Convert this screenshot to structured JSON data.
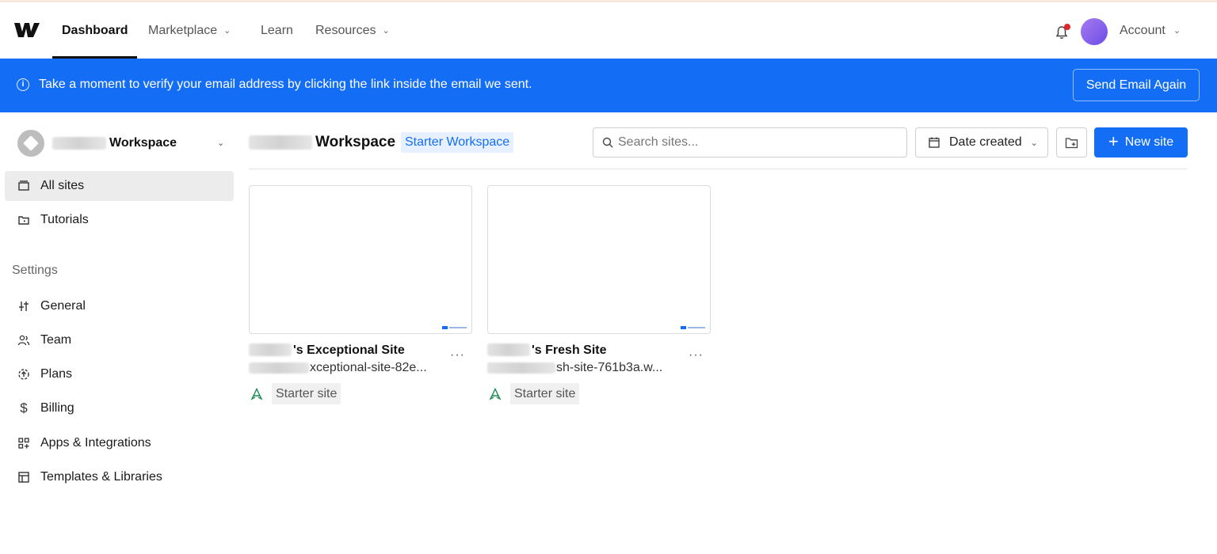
{
  "nav": {
    "items": [
      {
        "label": "Dashboard"
      },
      {
        "label": "Marketplace"
      },
      {
        "label": "Learn"
      },
      {
        "label": "Resources"
      }
    ],
    "account_label": "Account"
  },
  "banner": {
    "icon": "info-icon",
    "text": "Take a moment to verify your email address by clicking the link inside the email we sent.",
    "button_label": "Send Email Again"
  },
  "sidebar": {
    "workspace_name": "Workspace",
    "items": [
      {
        "label": "All sites",
        "icon": "all-sites-icon"
      },
      {
        "label": "Tutorials",
        "icon": "tutorials-icon"
      }
    ],
    "settings_heading": "Settings",
    "settings_items": [
      {
        "label": "General",
        "icon": "sliders-icon"
      },
      {
        "label": "Team",
        "icon": "team-icon"
      },
      {
        "label": "Plans",
        "icon": "plans-icon"
      },
      {
        "label": "Billing",
        "icon": "dollar-icon"
      },
      {
        "label": "Apps & Integrations",
        "icon": "apps-icon"
      },
      {
        "label": "Templates & Libraries",
        "icon": "templates-icon"
      }
    ]
  },
  "main": {
    "workspace_name": "Workspace",
    "workspace_badge": "Starter Workspace",
    "search_placeholder": "Search sites...",
    "sort_label": "Date created",
    "new_site_label": "New site"
  },
  "sites": [
    {
      "title": "'s Exceptional Site",
      "url": "xceptional-site-82e...",
      "plan": "Starter site"
    },
    {
      "title": "'s Fresh Site",
      "url": "sh-site-761b3a.w...",
      "plan": "Starter site"
    }
  ],
  "colors": {
    "accent": "#146ef5",
    "banner": "#146ef5",
    "notification_dot": "#e5252a"
  }
}
